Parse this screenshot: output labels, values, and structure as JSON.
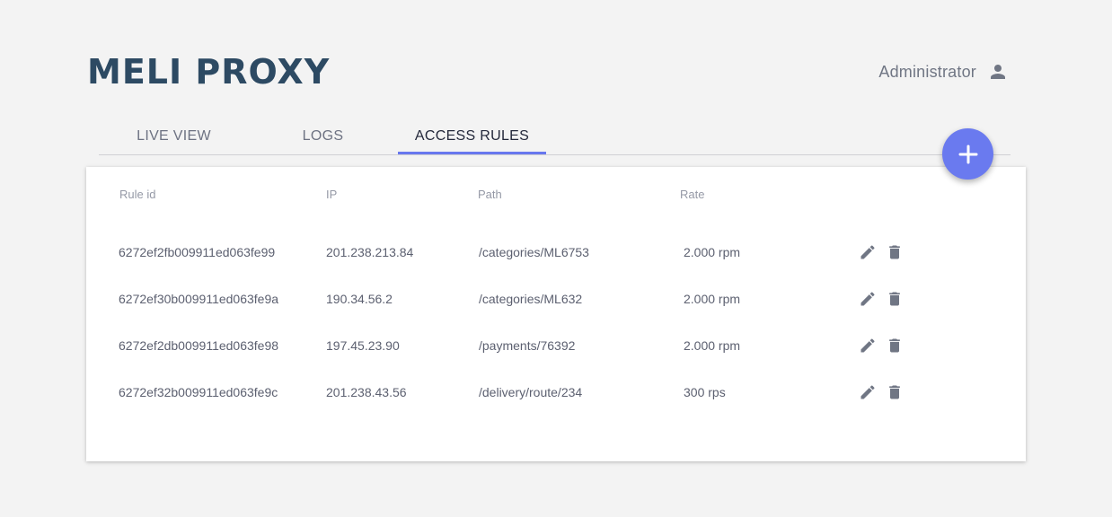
{
  "app": {
    "title": "MELI PROXY",
    "user_name": "Administrator",
    "user_icon": "person-icon"
  },
  "tabs": [
    {
      "label": "LIVE VIEW",
      "active": false
    },
    {
      "label": "LOGS",
      "active": false
    },
    {
      "label": "ACCESS RULES",
      "active": true
    }
  ],
  "add_button": {
    "icon": "plus-icon"
  },
  "table": {
    "headers": {
      "rule_id": "Rule id",
      "ip": "IP",
      "path": "Path",
      "rate": "Rate"
    },
    "rows": [
      {
        "rule_id": "6272ef2fb009911ed063fe99",
        "ip": "201.238.213.84",
        "path": "/categories/ML6753",
        "rate": "2.000 rpm"
      },
      {
        "rule_id": "6272ef30b009911ed063fe9a",
        "ip": "190.34.56.2",
        "path": "/categories/ML632",
        "rate": "2.000 rpm"
      },
      {
        "rule_id": "6272ef2db009911ed063fe98",
        "ip": "197.45.23.90",
        "path": "/payments/76392",
        "rate": "2.000 rpm"
      },
      {
        "rule_id": "6272ef32b009911ed063fe9c",
        "ip": "201.238.43.56",
        "path": "/delivery/route/234",
        "rate": "300 rps"
      }
    ],
    "row_actions": {
      "edit_icon": "pencil-icon",
      "delete_icon": "trash-icon"
    }
  },
  "colors": {
    "background": "#f3f3f3",
    "title": "#2d4a63",
    "accent": "#6a7aef",
    "icon": "#707684"
  }
}
